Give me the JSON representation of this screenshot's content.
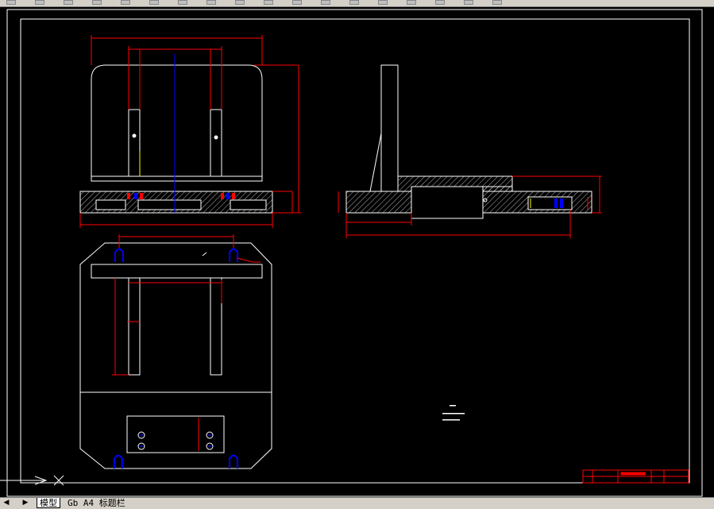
{
  "app": {
    "name": "AutoCAD drawing window"
  },
  "toolbar": {
    "buttons": [
      "tool-1",
      "tool-2",
      "tool-3",
      "tool-4",
      "tool-5",
      "tool-6",
      "tool-7",
      "tool-8",
      "tool-9",
      "tool-10",
      "tool-11",
      "tool-12",
      "tool-13",
      "tool-14",
      "tool-15",
      "tool-16",
      "tool-17",
      "tool-18"
    ]
  },
  "drawing": {
    "colors": {
      "background": "#000000",
      "outline": "#ffffff",
      "dimension": "#ff0000",
      "centerline": "#0000ff",
      "yellow": "#ffff00"
    }
  },
  "tabs": {
    "nav_first": "◀",
    "nav_next": "▶",
    "items": [
      {
        "label": "模型",
        "active": true
      },
      {
        "label": "Gb A4 标题栏",
        "active": false
      }
    ]
  }
}
